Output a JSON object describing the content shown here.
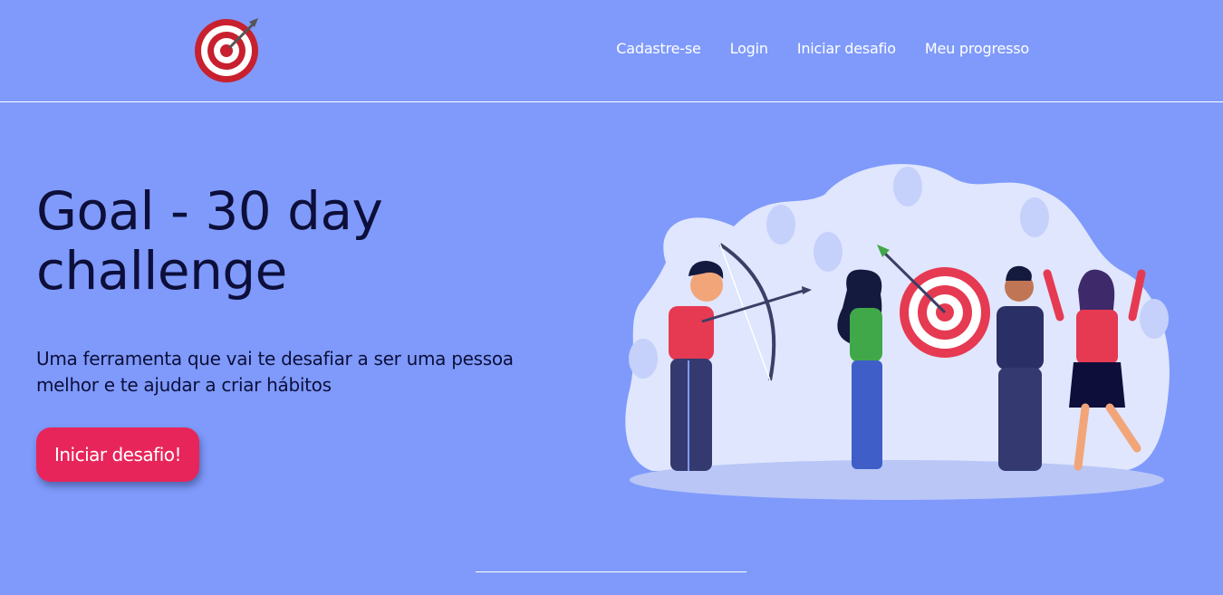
{
  "header": {
    "logo_icon": "target-dartboard-icon",
    "nav": [
      {
        "label": "Cadastre-se"
      },
      {
        "label": "Login"
      },
      {
        "label": "Iniciar desafio"
      },
      {
        "label": "Meu progresso"
      }
    ]
  },
  "hero": {
    "title": "Goal - 30 day challenge",
    "subtitle": "Uma ferramenta que vai te desafiar a ser uma pessoa melhor e te ajudar a criar hábitos",
    "cta_label": "Iniciar desafio!",
    "illustration": "team-archery-target-illustration"
  },
  "colors": {
    "background": "#7f9afb",
    "text_dark": "#0d0f3a",
    "cta": "#e7255a",
    "nav_text": "#ffffff"
  }
}
